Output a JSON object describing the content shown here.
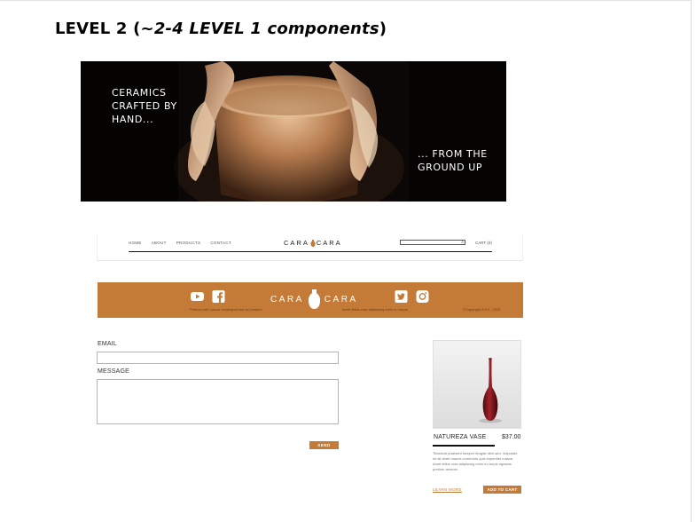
{
  "heading": {
    "prefix": "LEVEL 2 (",
    "italic": "~2-4 LEVEL 1 components",
    "suffix": ")"
  },
  "hero": {
    "left_lines": [
      "CERAMICS",
      "CRAFTED BY",
      "HAND..."
    ],
    "right_lines": [
      "... FROM THE",
      "GROUND UP"
    ]
  },
  "nav": {
    "links": [
      "HOME",
      "ABOUT",
      "PRODUCTS",
      "CONTACT"
    ],
    "logo_left": "CARA",
    "logo_right": "CARA",
    "cart": "CART (0)"
  },
  "footer": {
    "logo_left": "CARA",
    "logo_right": "CARA",
    "left_text": "Pretium nibh ipsum consequat nisl vel pretium",
    "mid_text": "Amet tellus cras adipiscing enim eu turpis",
    "copyright": "©Copyright 2013 - 2020",
    "icons": [
      "youtube-icon",
      "facebook-icon",
      "twitter-icon",
      "instagram-icon"
    ]
  },
  "form": {
    "email_label": "EMAIL",
    "email_value": "",
    "message_label": "MESSAGE",
    "message_value": "",
    "send_label": "SEND"
  },
  "product": {
    "name": "NATUREZA VASE",
    "price": "$37.00",
    "description": "Tincidunt praesent semper feugiat nibh sed. Vulputate mi sit amet mauris commodo quis imperdiet massa. Amet tellus cras adipiscing enim eu turpis egestas pretium aenean.",
    "learn_more": "LEARN MORE",
    "add_to_cart": "ADD TO CART"
  },
  "colors": {
    "accent": "#c47b37",
    "hero_bg": "#000000",
    "text": "#222222"
  }
}
